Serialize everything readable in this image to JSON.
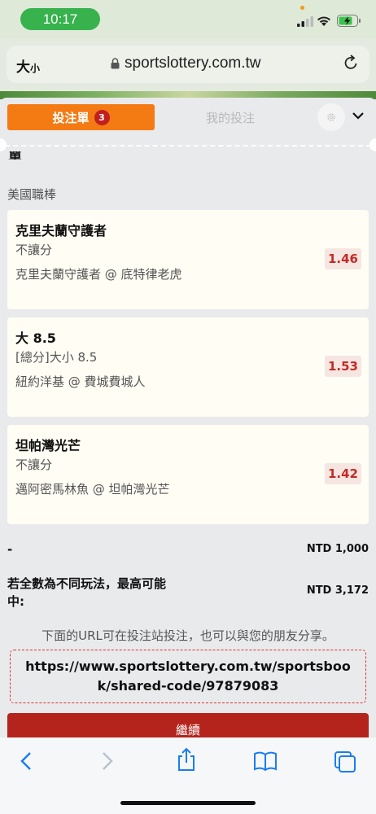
{
  "status_bar": {
    "time": "10:17"
  },
  "address_bar": {
    "text_size_label_big": "大",
    "text_size_label_small": "小",
    "url": "sportslottery.com.tw"
  },
  "betslip": {
    "tab_active": "投注單",
    "tab_count": "3",
    "tab_inactive": "我的投注",
    "cutoff_text": "單",
    "league": "美國職棒",
    "bets": [
      {
        "selection": "克里夫蘭守護者",
        "market": "不讓分",
        "match": "克里夫蘭守護者 @ 底特律老虎",
        "odds": "1.46"
      },
      {
        "selection": "大 8.5",
        "market": "[總分]大小 8.5",
        "match": "紐約洋基 @ 費城費城人",
        "odds": "1.53"
      },
      {
        "selection": "坦帕灣光芒",
        "market": "不讓分",
        "match": "邁阿密馬林魚 @ 坦帕灣光芒",
        "odds": "1.42"
      }
    ],
    "stake_label": "-",
    "stake_value": "NTD 1,000",
    "max_win_label": "若全數為不同玩法，最高可能中:",
    "max_win_value": "NTD 3,172",
    "share_note": "下面的URL可在投注站投注，也可以與您的朋友分享。",
    "share_url": "https://www.sportslottery.com.tw/sportsbook/shared-code/97879083",
    "continue_label": "繼續"
  },
  "colors": {
    "accent": "#f47a14",
    "odds_text": "#c52a25",
    "continue_bg": "#b4231c",
    "tab_badge": "#c21f1f"
  }
}
